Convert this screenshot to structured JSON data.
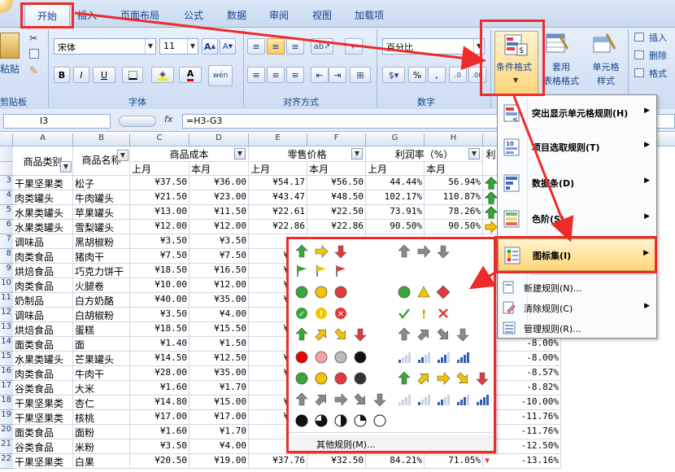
{
  "ribbon": {
    "tabs": [
      "开始",
      "插入",
      "页面布局",
      "公式",
      "数据",
      "审阅",
      "视图",
      "加载项"
    ],
    "clipboard": {
      "paste_label": "粘贴",
      "group_label": "剪贴板"
    },
    "font": {
      "name": "宋体",
      "size": "11",
      "group_label": "字体",
      "bold": "B",
      "italic": "I",
      "underline": "U",
      "phonetic": "wén",
      "grow": "A",
      "shrink": "A"
    },
    "alignment": {
      "group_label": "对齐方式"
    },
    "number": {
      "format": "百分比",
      "group_label": "数字",
      "percent": "%",
      "comma": ","
    },
    "styles": {
      "conditional_format": "条件格式",
      "table_format": "套用\n表格格式",
      "cell_style": "单元格\n样式"
    },
    "cells": {
      "insert": "插入",
      "delete": "删除",
      "format": "格式"
    }
  },
  "formula_bar": {
    "cell_ref": "I3",
    "fx": "fx",
    "formula": "=H3-G3"
  },
  "columns": [
    "A",
    "B",
    "C",
    "D",
    "E",
    "F",
    "G",
    "H"
  ],
  "header": {
    "category": "商品类别",
    "name": "商品名称",
    "cost": "商品成本",
    "price": "零售价格",
    "margin": "利润率（%）",
    "i_col": "利",
    "last_month": "上月",
    "this_month": "本月"
  },
  "rows": [
    {
      "n": "3",
      "a": "干果坚果类",
      "b": "松子",
      "c": "¥37.50",
      "d": "¥36.00",
      "e": "¥54.17",
      "f": "¥56.50",
      "g": "44.44%",
      "h": "56.94%",
      "i": "up"
    },
    {
      "n": "4",
      "a": "肉类罐头",
      "b": "牛肉罐头",
      "c": "¥21.50",
      "d": "¥23.00",
      "e": "¥43.47",
      "f": "¥48.50",
      "g": "102.17%",
      "h": "110.87%",
      "i": "up"
    },
    {
      "n": "5",
      "a": "水果类罐头",
      "b": "苹果罐头",
      "c": "¥13.00",
      "d": "¥11.50",
      "e": "¥22.61",
      "f": "¥22.50",
      "g": "73.91%",
      "h": "78.26%",
      "i": "up"
    },
    {
      "n": "6",
      "a": "水果类罐头",
      "b": "雪梨罐头",
      "c": "¥12.00",
      "d": "¥12.00",
      "e": "¥22.86",
      "f": "¥22.86",
      "g": "90.50%",
      "h": "90.50%",
      "i": "right"
    },
    {
      "n": "7",
      "a": "调味品",
      "b": "黑胡椒粉",
      "c": "¥3.50",
      "d": "¥3.50",
      "e": "¥4.",
      "f": "",
      "g": "",
      "h": "",
      "i": ""
    },
    {
      "n": "8",
      "a": "肉类食品",
      "b": "猪肉干",
      "c": "¥7.50",
      "d": "¥7.50",
      "e": "¥11.",
      "f": "",
      "g": "",
      "h": "",
      "i": ""
    },
    {
      "n": "9",
      "a": "烘焙食品",
      "b": "巧克力饼干",
      "c": "¥18.50",
      "d": "¥16.50",
      "e": "¥31.",
      "f": "",
      "g": "",
      "h": "",
      "i": ""
    },
    {
      "n": "10",
      "a": "肉类食品",
      "b": "火腿卷",
      "c": "¥10.00",
      "d": "¥12.00",
      "e": "¥15.",
      "f": "",
      "g": "",
      "h": "",
      "i": ""
    },
    {
      "n": "11",
      "a": "奶制品",
      "b": "白方奶酪",
      "c": "¥40.00",
      "d": "¥35.00",
      "e": "¥72.",
      "f": "",
      "g": "",
      "h": "",
      "i": ""
    },
    {
      "n": "12",
      "a": "调味品",
      "b": "白胡椒粉",
      "c": "¥3.50",
      "d": "¥4.00",
      "e": "¥4.",
      "f": "",
      "g": "",
      "h": "",
      "i": ""
    },
    {
      "n": "13",
      "a": "烘焙食品",
      "b": "蛋糕",
      "c": "¥18.50",
      "d": "¥15.50",
      "e": "¥29.",
      "f": "",
      "g": "",
      "h": "",
      "i": ""
    },
    {
      "n": "14",
      "a": "面类食品",
      "b": "面",
      "c": "¥1.40",
      "d": "¥1.50",
      "e": "¥2.",
      "f": "",
      "g": "",
      "h": "",
      "i": "-8.00%"
    },
    {
      "n": "15",
      "a": "水果类罐头",
      "b": "芒果罐头",
      "c": "¥14.50",
      "d": "¥12.50",
      "e": "¥26.",
      "f": "",
      "g": "",
      "h": "",
      "i": "-8.00%"
    },
    {
      "n": "16",
      "a": "肉类食品",
      "b": "牛肉干",
      "c": "¥28.00",
      "d": "¥35.00",
      "e": "¥54.",
      "f": "",
      "g": "",
      "h": "",
      "i": "-8.57%"
    },
    {
      "n": "17",
      "a": "谷类食品",
      "b": "大米",
      "c": "¥1.60",
      "d": "¥1.70",
      "e": "¥2.",
      "f": "",
      "g": "",
      "h": "",
      "i": "-8.82%"
    },
    {
      "n": "18",
      "a": "干果坚果类",
      "b": "杏仁",
      "c": "¥14.80",
      "d": "¥15.00",
      "e": "¥21.",
      "f": "",
      "g": "",
      "h": "",
      "i": "-10.00%"
    },
    {
      "n": "19",
      "a": "干果坚果类",
      "b": "核桃",
      "c": "¥17.00",
      "d": "¥17.00",
      "e": "¥25.",
      "f": "",
      "g": "",
      "h": "",
      "i": "-11.76%"
    },
    {
      "n": "20",
      "a": "面类食品",
      "b": "面粉",
      "c": "¥1.60",
      "d": "¥1.70",
      "e": "¥2.",
      "f": "",
      "g": "",
      "h": "",
      "i": "-11.76%"
    },
    {
      "n": "21",
      "a": "谷类食品",
      "b": "米粉",
      "c": "¥3.50",
      "d": "¥4.00",
      "e": "¥6.",
      "f": "",
      "g": "",
      "h": "",
      "i": "-12.50%"
    },
    {
      "n": "22",
      "a": "干果坚果类",
      "b": "白果",
      "c": "¥20.50",
      "d": "¥19.00",
      "e": "¥37.76",
      "f": "¥32.50",
      "g": "84.21%",
      "h": "71.05%",
      "i": "-13.16%"
    }
  ],
  "cf_menu": {
    "highlight_rules": "突出显示单元格规则(H)",
    "top_bottom": "项目选取规则(T)",
    "data_bars": "数据条(D)",
    "color_scales": "色阶(S)",
    "icon_sets": "图标集(I)",
    "new_rule": "新建规则(N)...",
    "clear_rules": "清除规则(C)",
    "manage_rules": "管理规则(R)..."
  },
  "icon_gallery": {
    "more_rules": "其他规则(M)..."
  },
  "colors": {
    "highlight": "#ed2b2b",
    "green": "#3aa53a",
    "yellow": "#f5c400",
    "red": "#e03b3b",
    "grey": "#8a8a8a"
  }
}
